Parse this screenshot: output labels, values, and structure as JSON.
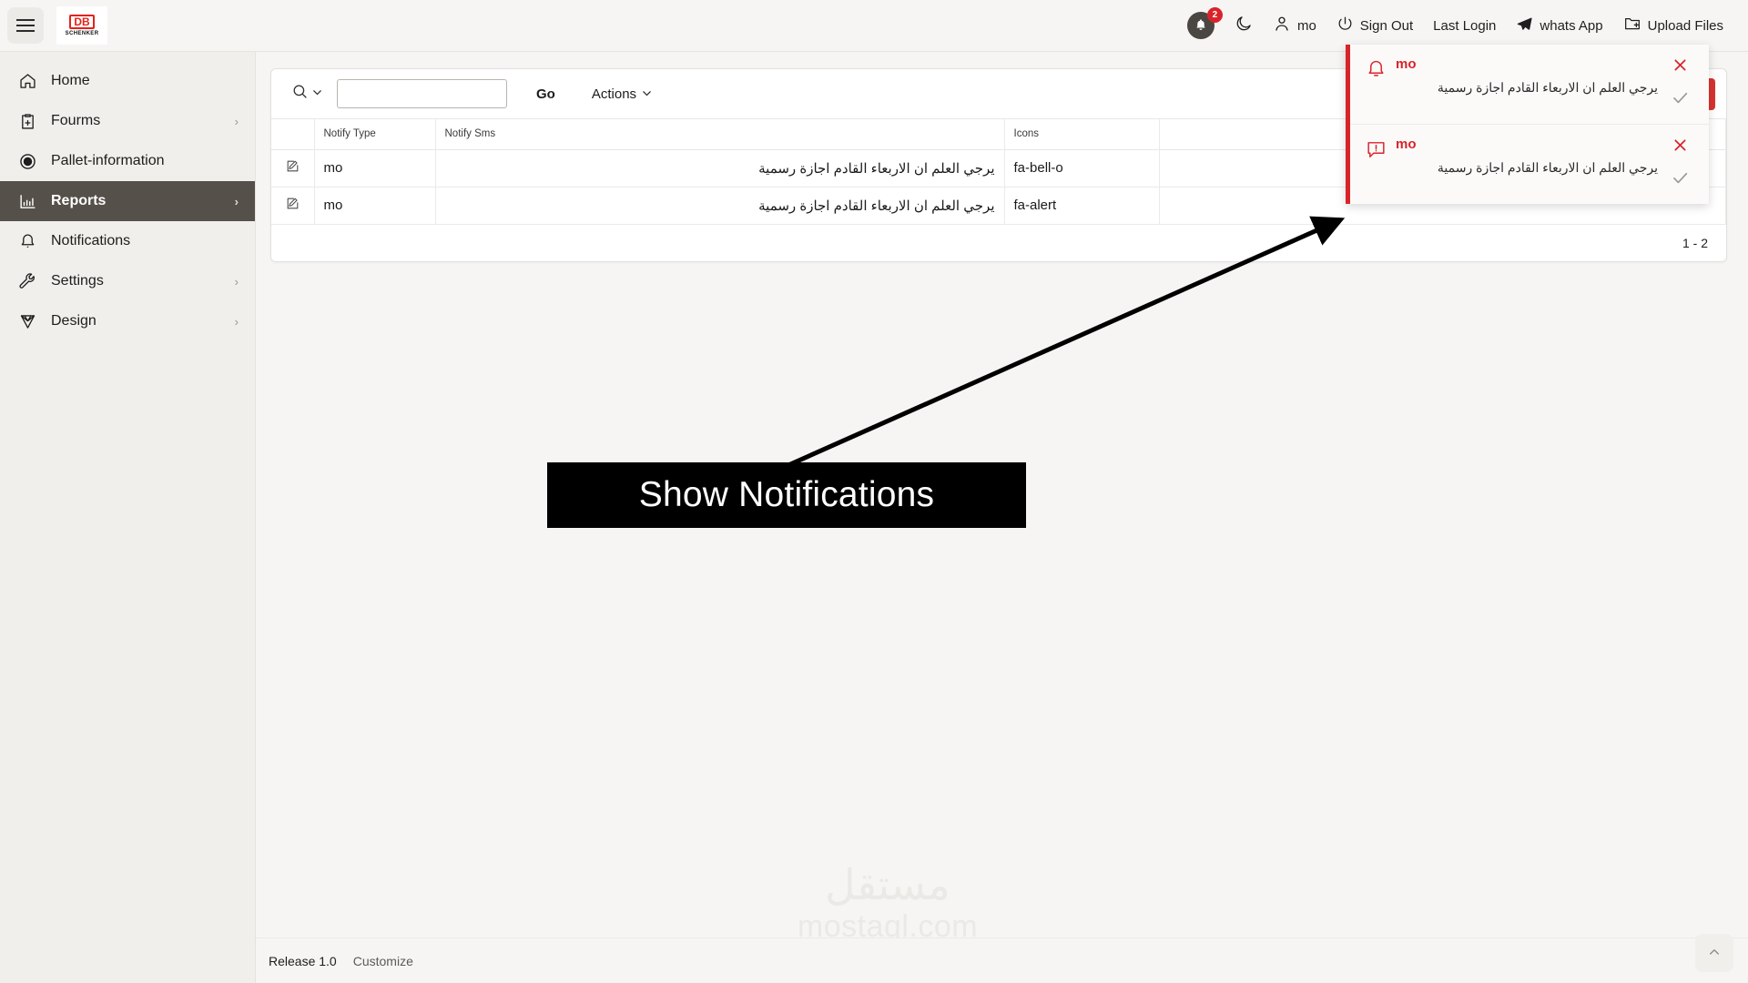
{
  "header": {
    "menu_icon": "hamburger-icon",
    "logo": {
      "primary": "DB",
      "secondary": "SCHENKER"
    },
    "notifications": {
      "icon": "bell-icon",
      "badge_count": "2"
    },
    "dark_mode": {
      "icon": "moon-icon"
    },
    "user": {
      "icon": "user-icon",
      "name": "mo"
    },
    "sign_out": {
      "icon": "power-icon",
      "label": "Sign Out"
    },
    "last_login": {
      "label": "Last Login"
    },
    "whats_app": {
      "icon": "paper-plane-icon",
      "label": "whats App"
    },
    "upload_files": {
      "icon": "folder-plus-icon",
      "label": "Upload Files"
    }
  },
  "sidebar": {
    "items": [
      {
        "label": "Home",
        "icon": "home-icon",
        "has_chevron": false,
        "active": false
      },
      {
        "label": "Fourms",
        "icon": "clipboard-plus-icon",
        "has_chevron": true,
        "active": false
      },
      {
        "label": "Pallet-information",
        "icon": "circle-dot-icon",
        "has_chevron": false,
        "active": false
      },
      {
        "label": "Reports",
        "icon": "bar-chart-icon",
        "has_chevron": true,
        "active": true
      },
      {
        "label": "Notifications",
        "icon": "bell-icon",
        "has_chevron": false,
        "active": false
      },
      {
        "label": "Settings",
        "icon": "wrench-icon",
        "has_chevron": true,
        "active": false
      },
      {
        "label": "Design",
        "icon": "diamond-icon",
        "has_chevron": true,
        "active": false
      }
    ]
  },
  "toolbar": {
    "search_icon": "magnifier-icon",
    "search_value": "",
    "search_placeholder": "",
    "go_label": "Go",
    "actions_label": "Actions",
    "primary_button_label": ""
  },
  "table": {
    "columns": [
      "",
      "Notify Type",
      "Notify Sms",
      "Icons"
    ],
    "rows": [
      {
        "edit_icon": "edit-pencil-icon",
        "notify_type": "mo",
        "notify_sms": "يرجي العلم ان الاربعاء القادم اجازة رسمية",
        "icons": "fa-bell-o"
      },
      {
        "edit_icon": "edit-pencil-icon",
        "notify_type": "mo",
        "notify_sms": "يرجي العلم ان الاربعاء القادم اجازة رسمية",
        "icons": "fa-alert"
      }
    ],
    "pagination": "1 - 2"
  },
  "notification_panel": {
    "items": [
      {
        "icon": "bell-outline-icon",
        "title": "mo",
        "message": "يرجي العلم ان الاربعاء القادم اجازة رسمية",
        "dismiss_icon": "close-x-icon",
        "confirm_icon": "check-icon"
      },
      {
        "icon": "alert-comment-icon",
        "title": "mo",
        "message": "يرجي العلم ان الاربعاء القادم اجازة رسمية",
        "dismiss_icon": "close-x-icon",
        "confirm_icon": "check-icon"
      }
    ]
  },
  "annotation": {
    "label": "Show Notifications"
  },
  "watermark": {
    "arabic": "مستقل",
    "latin": "mostaql.com"
  },
  "footer": {
    "release": "Release 1.0",
    "customize": "Customize",
    "to_top_icon": "chevron-up-icon"
  },
  "colors": {
    "brand_red": "#d9232a",
    "accent_button": "#d9332f",
    "sidebar_bg": "#f1efec",
    "active_nav": "#55504a",
    "page_bg": "#f6f5f3"
  }
}
